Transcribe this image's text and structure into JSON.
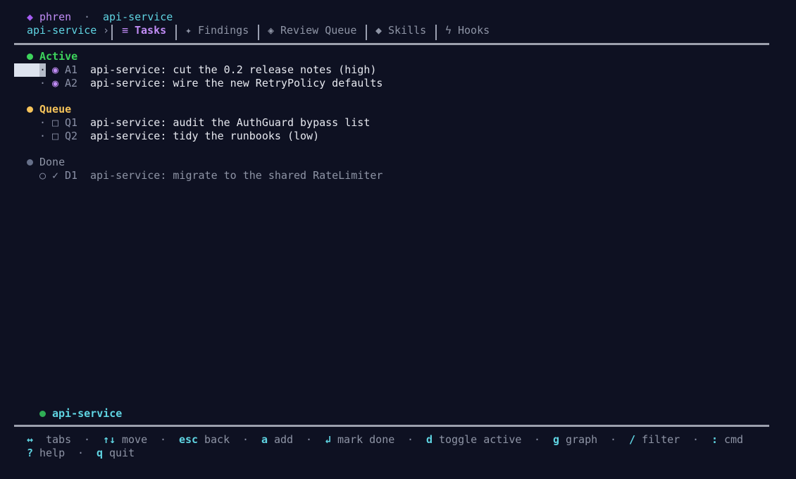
{
  "header": {
    "app_icon": "diamond-icon",
    "app_name": "phren",
    "separator": "·",
    "project": "api-service"
  },
  "nav": {
    "project_crumb": "api-service",
    "crumb_arrow": "›",
    "tabs": [
      {
        "icon": "≡",
        "label": "Tasks",
        "active": true
      },
      {
        "icon": "✦",
        "label": "Findings",
        "active": false
      },
      {
        "icon": "◈",
        "label": "Review Queue",
        "active": false
      },
      {
        "icon": "◆",
        "label": "Skills",
        "active": false
      },
      {
        "icon": "ϟ",
        "label": "Hooks",
        "active": false
      }
    ]
  },
  "sections": [
    {
      "title": "Active",
      "color": "#3dd45c",
      "items": [
        {
          "id": "A1",
          "marker": "◉",
          "text": "api-service: cut the 0.2 release notes (high)",
          "selected": true
        },
        {
          "id": "A2",
          "marker": "◉",
          "text": "api-service: wire the new RetryPolicy defaults",
          "selected": false
        }
      ]
    },
    {
      "title": "Queue",
      "color": "#f5c35a",
      "items": [
        {
          "id": "Q1",
          "marker": "□",
          "text": "api-service: audit the AuthGuard bypass list",
          "selected": false
        },
        {
          "id": "Q2",
          "marker": "□",
          "text": "api-service: tidy the runbooks (low)",
          "selected": false
        }
      ]
    },
    {
      "title": "Done",
      "color": "#667089",
      "items": [
        {
          "id": "D1",
          "marker": "✓",
          "prefix": "○",
          "text": "api-service: migrate to the shared RateLimiter",
          "selected": false
        }
      ]
    }
  ],
  "bullet": "·",
  "status": {
    "project": "api-service",
    "color": "#2fae55"
  },
  "footer": {
    "sep": "·",
    "hints_row1": [
      {
        "key": "↔",
        "label": "tabs"
      },
      {
        "key": "↑↓",
        "label": "move"
      },
      {
        "key": "esc",
        "label": "back"
      },
      {
        "key": "a",
        "label": "add"
      },
      {
        "key": "↲",
        "label": "mark done"
      },
      {
        "key": "d",
        "label": "toggle active"
      },
      {
        "key": "g",
        "label": "graph"
      },
      {
        "key": "/",
        "label": "filter"
      },
      {
        "key": ":",
        "label": "cmd"
      }
    ],
    "hints_row2": [
      {
        "key": "?",
        "label": "help"
      },
      {
        "key": "q",
        "label": "quit"
      }
    ]
  },
  "colors": {
    "background": "#0e1122",
    "accent_purple": "#a55cf2",
    "accent_cyan": "#5fd4e2",
    "rule": "#9ca0ad"
  }
}
